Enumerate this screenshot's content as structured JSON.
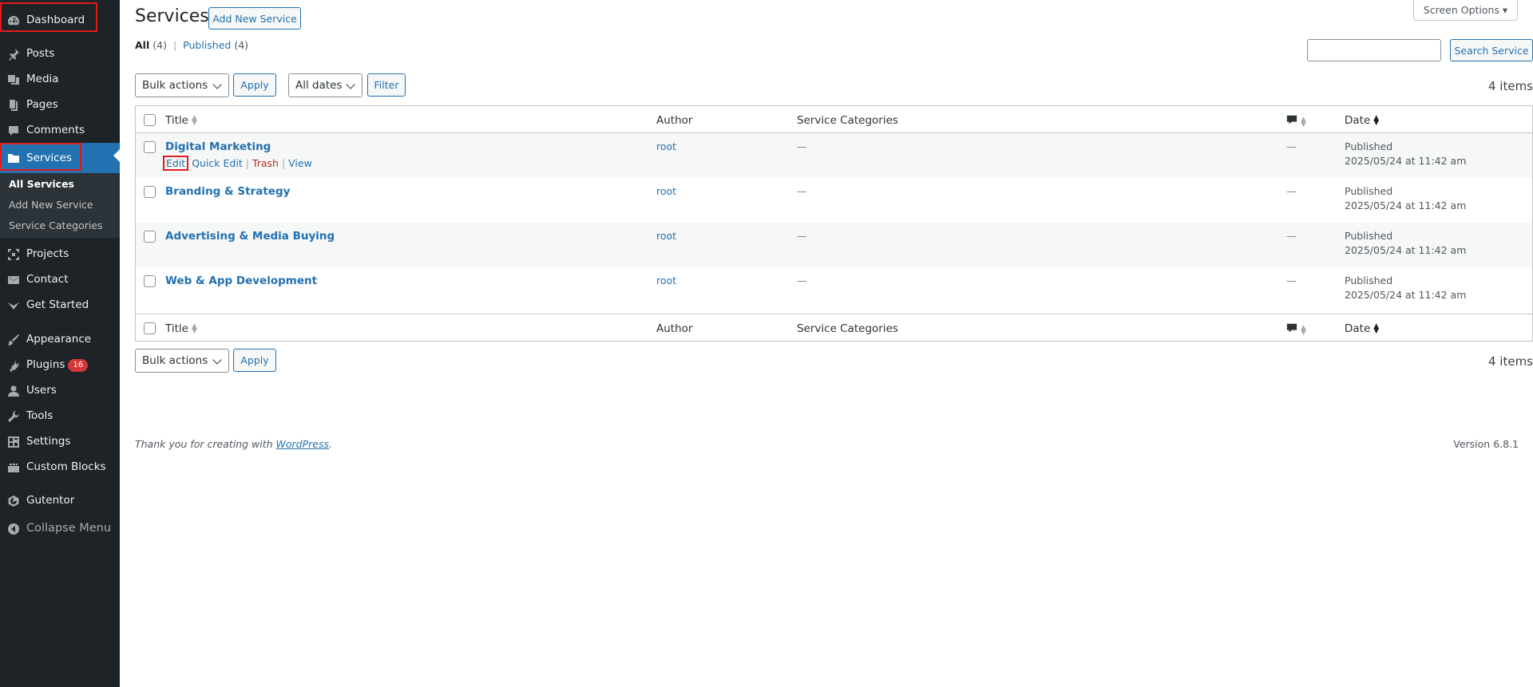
{
  "sidebar": {
    "items": [
      {
        "label": "Dashboard",
        "icon": "dashboard-icon"
      },
      {
        "label": "Posts",
        "icon": "pin-icon"
      },
      {
        "label": "Media",
        "icon": "media-icon"
      },
      {
        "label": "Pages",
        "icon": "pages-icon"
      },
      {
        "label": "Comments",
        "icon": "comment-icon"
      },
      {
        "label": "Services",
        "icon": "folder-icon"
      },
      {
        "label": "Projects",
        "icon": "projects-icon"
      },
      {
        "label": "Contact",
        "icon": "mail-icon"
      },
      {
        "label": "Get Started",
        "icon": "get-started-icon"
      },
      {
        "label": "Appearance",
        "icon": "brush-icon"
      },
      {
        "label": "Plugins",
        "icon": "plugin-icon",
        "badge": "16"
      },
      {
        "label": "Users",
        "icon": "user-icon"
      },
      {
        "label": "Tools",
        "icon": "wrench-icon"
      },
      {
        "label": "Settings",
        "icon": "settings-icon"
      },
      {
        "label": "Custom Blocks",
        "icon": "blocks-icon"
      },
      {
        "label": "Gutentor",
        "icon": "gutentor-icon"
      },
      {
        "label": "Collapse Menu",
        "icon": "collapse-icon"
      }
    ],
    "submenu": [
      "All Services",
      "Add New Service",
      "Service Categories"
    ]
  },
  "header": {
    "title": "Services",
    "add_new": "Add New Service",
    "screen_options": "Screen Options ▾"
  },
  "filters": {
    "all": "All",
    "all_count": "(4)",
    "sep": "|",
    "published": "Published",
    "published_count": "(4)"
  },
  "search": {
    "button": "Search Service",
    "value": ""
  },
  "toolbar": {
    "bulk_actions": "Bulk actions",
    "apply": "Apply",
    "all_dates": "All dates",
    "filter": "Filter",
    "items_count": "4 items"
  },
  "table": {
    "columns": {
      "title": "Title",
      "author": "Author",
      "categories": "Service Categories",
      "date": "Date"
    },
    "row_actions": {
      "edit": "Edit",
      "quick_edit": "Quick Edit",
      "trash": "Trash",
      "view": "View",
      "sep": "|"
    },
    "rows": [
      {
        "title": "Digital Marketing",
        "author": "root",
        "categories": "—",
        "comments": "—",
        "status": "Published",
        "date": "2025/05/24 at 11:42 am"
      },
      {
        "title": "Branding & Strategy",
        "author": "root",
        "categories": "—",
        "comments": "—",
        "status": "Published",
        "date": "2025/05/24 at 11:42 am"
      },
      {
        "title": "Advertising & Media Buying",
        "author": "root",
        "categories": "—",
        "comments": "—",
        "status": "Published",
        "date": "2025/05/24 at 11:42 am"
      },
      {
        "title": "Web & App Development",
        "author": "root",
        "categories": "—",
        "comments": "—",
        "status": "Published",
        "date": "2025/05/24 at 11:42 am"
      }
    ]
  },
  "footer": {
    "thanks": "Thank you for creating with",
    "wordpress": "WordPress",
    "period": ".",
    "version": "Version 6.8.1"
  },
  "colors": {
    "accent": "#2271b1",
    "sidebar": "#1d2327",
    "highlight": "#e11b1b",
    "trash": "#b32d2e"
  }
}
